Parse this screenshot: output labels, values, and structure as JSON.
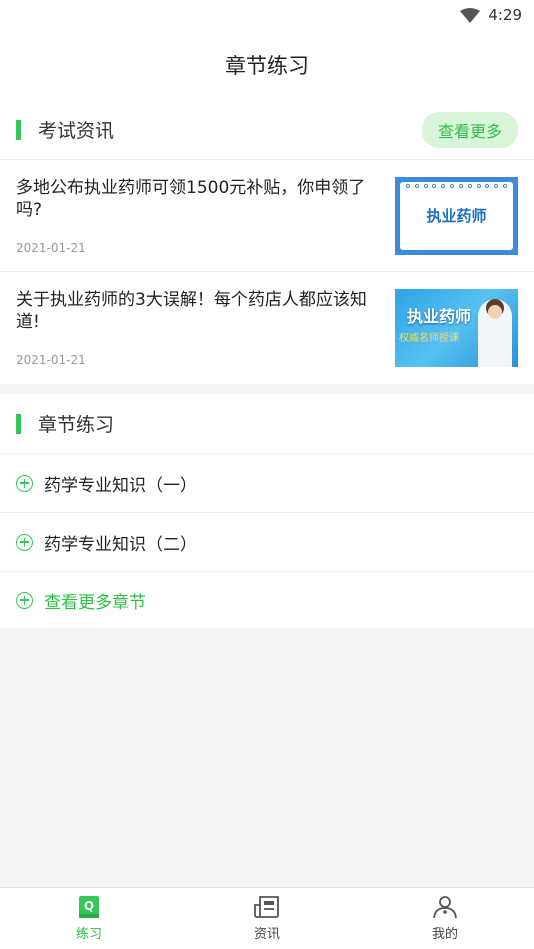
{
  "status_bar": {
    "time": "4:29"
  },
  "page_title": "章节练习",
  "news": {
    "title": "考试资讯",
    "more_label": "查看更多",
    "items": [
      {
        "title": "多地公布执业药师可领1500元补贴，你申领了吗?",
        "date": "2021-01-21",
        "thumb_text": "执业药师"
      },
      {
        "title": "关于执业药师的3大误解！每个药店人都应该知道!",
        "date": "2021-01-21",
        "thumb_text": "执业药师",
        "thumb_subtext": "权威名师授课"
      }
    ]
  },
  "chapters": {
    "title": "章节练习",
    "items": [
      {
        "label": "药学专业知识（一）"
      },
      {
        "label": "药学专业知识（二）"
      }
    ],
    "more_label": "查看更多章节"
  },
  "tabbar": {
    "items": [
      {
        "label": "练习",
        "icon": "practice-book-icon",
        "active": true
      },
      {
        "label": "资讯",
        "icon": "news-icon",
        "active": false
      },
      {
        "label": "我的",
        "icon": "profile-icon",
        "active": false
      }
    ]
  },
  "colors": {
    "accent": "#34c759",
    "accent_text": "#2fbf47",
    "more_bg": "#d8f5da"
  }
}
